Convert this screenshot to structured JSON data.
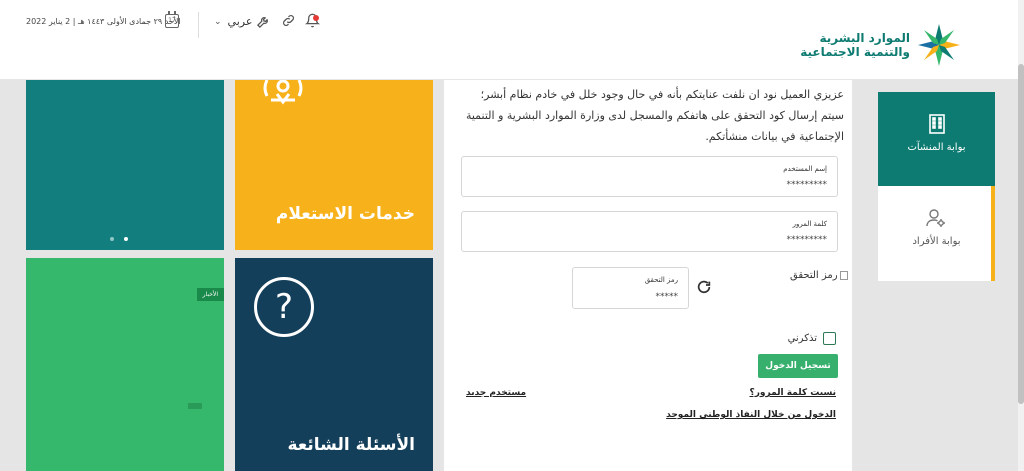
{
  "header": {
    "date": "الأحد ٢٩ جمادى الأولى ١٤٤٣ هـ | 2 يناير 2022",
    "calendar_day": "17",
    "language": "عربي",
    "logo": {
      "line1": "الموارد البشرية",
      "line2": "والتنمية الاجتماعية"
    }
  },
  "tiles": {
    "inquiry_title": "خدمات الاستعلام",
    "faq_title": "الأسئلة الشائعة",
    "news_badge": "الأخبار"
  },
  "form": {
    "intro": "عزيزي العميل نود ان نلفت عنايتكم بأنه في حال وجود خلل في خادم نظام أبشر؛ سيتم إرسال كود التحقق على هاتفكم والمسجل لدى وزارة الموارد البشرية و التنمية الإجتماعية في بيانات منشأتكم.",
    "username_label": "إسم المستخدم",
    "username_value": "*********",
    "password_label": "كلمة المرور",
    "password_value": "*********",
    "captcha_label": "رمز التحقق",
    "captcha_value": "*****",
    "captcha_alt": "رمز التحقق",
    "remember_label": "تذكرني",
    "login_button": "تسجيل الدخول",
    "forgot_password": "نسيت كلمة المرور؟",
    "new_user": "مستخدم جديد",
    "nafath_login": "الدخول من خلال النفاذ الوطني الموحد"
  },
  "portals": {
    "establishments": "بوابة المنشآت",
    "individuals": "بوابة الأفراد"
  },
  "colors": {
    "teal": "#127e7e",
    "yellow": "#f7b21b",
    "green": "#35b76c",
    "navy": "#143f5a",
    "primary": "#0d7b71"
  }
}
